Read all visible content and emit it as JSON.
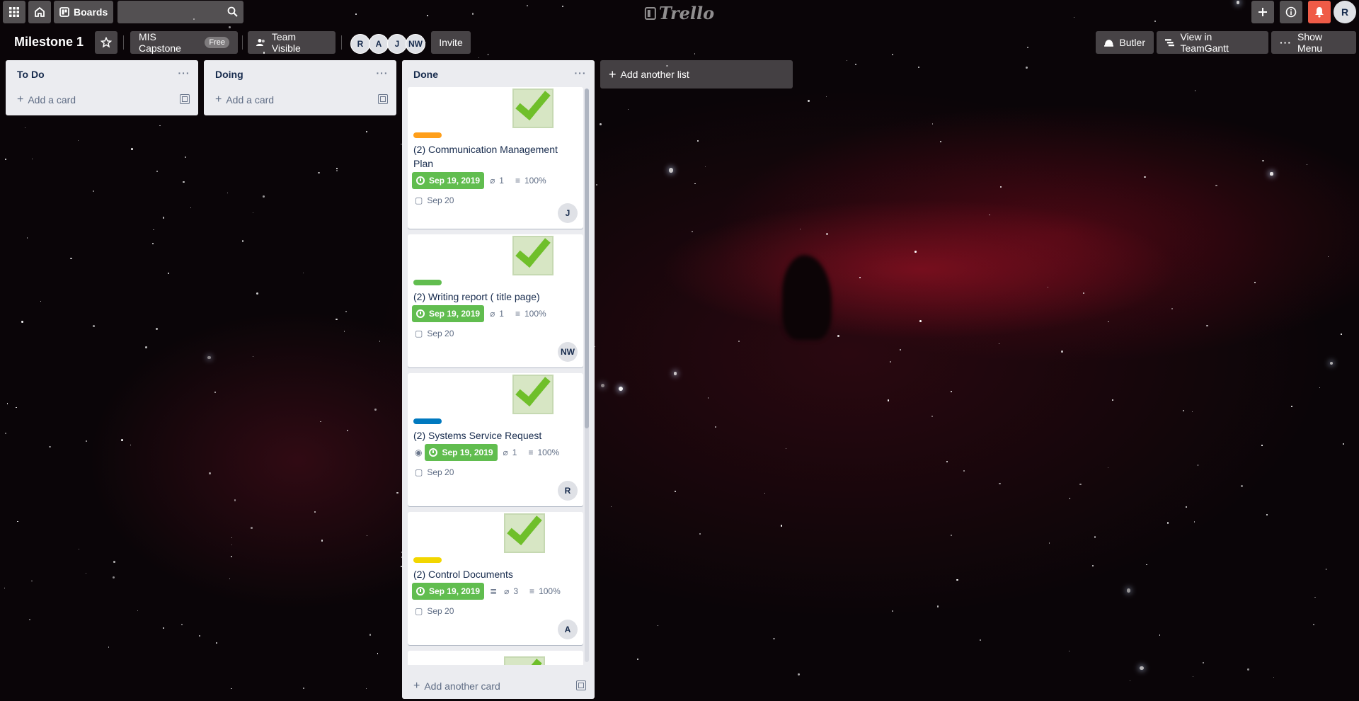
{
  "header": {
    "apps_icon": "apps-grid-icon",
    "home_icon": "home-icon",
    "boards_label": "Boards",
    "search_placeholder": "",
    "logo_text": "Trello",
    "right_icons": [
      "plus-icon",
      "info-icon",
      "bell-icon"
    ],
    "user_initial": "R"
  },
  "board": {
    "title": "Milestone 1",
    "team_name": "MIS Capstone",
    "team_plan": "Free",
    "visibility": "Team Visible",
    "members": [
      "R",
      "A",
      "J",
      "NW"
    ],
    "invite_label": "Invite",
    "butler_label": "Butler",
    "teamgantt_label": "View in TeamGantt",
    "show_menu_label": "Show Menu"
  },
  "lists": [
    {
      "title": "To Do",
      "add_label": "Add a card"
    },
    {
      "title": "Doing",
      "add_label": "Add a card"
    },
    {
      "title": "Done",
      "add_label": "Add another card",
      "cards": [
        {
          "title": "(2) Communication Management Plan",
          "label_color": "#ff9f1a",
          "due": "Sep 19, 2019",
          "attachments": "1",
          "checklist": "100%",
          "start": "Sep 20",
          "member": "J",
          "watching": false,
          "description": false
        },
        {
          "title": "(2) Writing report ( title page)",
          "label_color": "#61bd4f",
          "due": "Sep 19, 2019",
          "attachments": "1",
          "checklist": "100%",
          "start": "Sep 20",
          "member": "NW",
          "watching": false,
          "description": false
        },
        {
          "title": "(2) Systems Service Request",
          "label_color": "#0079bf",
          "due": "Sep 19, 2019",
          "attachments": "1",
          "checklist": "100%",
          "start": "Sep 20",
          "member": "R",
          "watching": true,
          "description": false
        },
        {
          "title": "(2) Control Documents",
          "label_color": "#f2d600",
          "due": "Sep 19, 2019",
          "attachments": "3",
          "checklist": "100%",
          "start": "Sep 20",
          "member": "A",
          "watching": false,
          "description": true
        }
      ]
    }
  ],
  "add_list_label": "Add another list",
  "colors": {
    "due_complete": "#61bd4f",
    "list_bg": "#ebecf0",
    "notification": "#ef5b47"
  }
}
